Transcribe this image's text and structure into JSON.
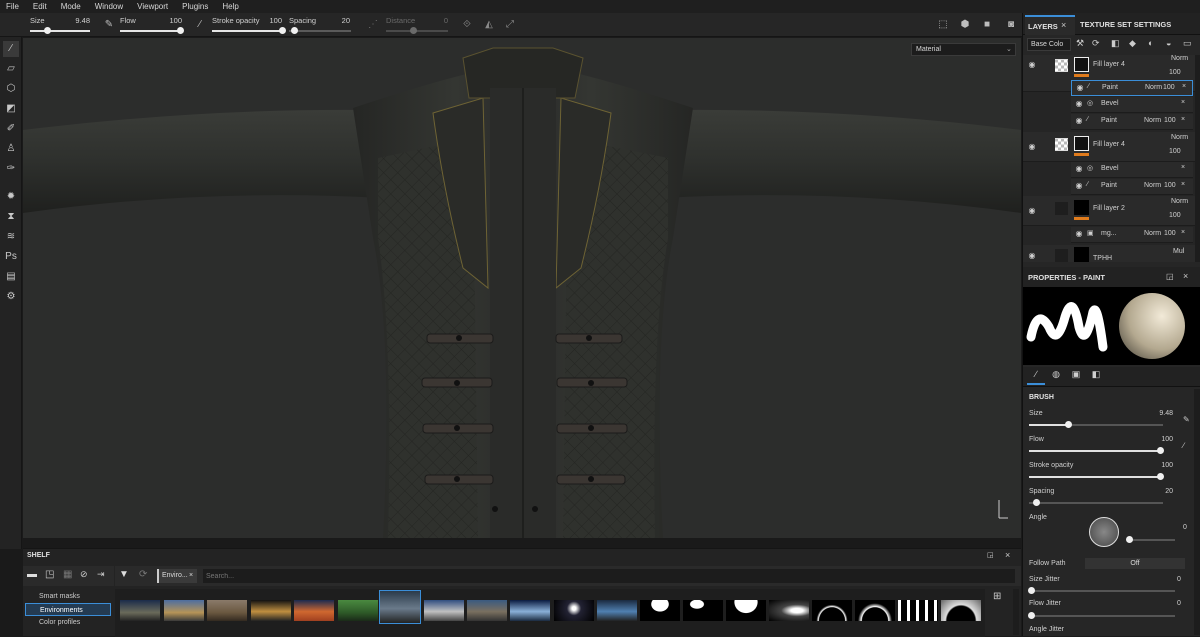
{
  "menu": [
    "File",
    "Edit",
    "Mode",
    "Window",
    "Viewport",
    "Plugins",
    "Help"
  ],
  "toolbar": {
    "size_label": "Size",
    "size_value": "9.48",
    "flow_label": "Flow",
    "flow_value": "100",
    "stroke_label": "Stroke opacity",
    "stroke_value": "100",
    "spacing_label": "Spacing",
    "spacing_value": "20",
    "distance_label": "Distance",
    "distance_value": "0"
  },
  "viewport": {
    "material_select": "Material"
  },
  "tabs": {
    "layers": "LAYERS",
    "texture_set": "TEXTURE SET SETTINGS"
  },
  "layers": {
    "channel_select": "Base Colo",
    "rows": [
      {
        "name": "Fill layer 4",
        "blend": "Norm",
        "opacity": "100"
      },
      {
        "name": "Paint",
        "blend": "Norm",
        "opacity": "100"
      },
      {
        "name": "Bevel",
        "blend": "",
        "opacity": ""
      },
      {
        "name": "Paint",
        "blend": "Norm",
        "opacity": "100"
      },
      {
        "name": "Fill layer 4",
        "blend": "Norm",
        "opacity": "100"
      },
      {
        "name": "Bevel",
        "blend": "",
        "opacity": ""
      },
      {
        "name": "Paint",
        "blend": "Norm",
        "opacity": "100"
      },
      {
        "name": "Fill layer 2",
        "blend": "Norm",
        "opacity": "100"
      },
      {
        "name": "mg...",
        "blend": "Norm",
        "opacity": "100"
      },
      {
        "name": "TPHH",
        "blend": "Mul",
        "opacity": ""
      }
    ]
  },
  "properties": {
    "title": "PROPERTIES - PAINT",
    "section": "BRUSH",
    "size_label": "Size",
    "size_value": "9.48",
    "flow_label": "Flow",
    "flow_value": "100",
    "stroke_label": "Stroke opacity",
    "stroke_value": "100",
    "spacing_label": "Spacing",
    "spacing_value": "20",
    "angle_label": "Angle",
    "angle_value": "0",
    "follow_path_label": "Follow Path",
    "follow_path_value": "Off",
    "size_jitter_label": "Size Jitter",
    "size_jitter_value": "0",
    "flow_jitter_label": "Flow Jitter",
    "flow_jitter_value": "0",
    "angle_jitter_label": "Angle Jitter"
  },
  "shelf": {
    "title": "SHELF",
    "categories": [
      "Smart masks",
      "Environments",
      "Color profiles"
    ],
    "filter_tag": "Enviro...",
    "search_placeholder": "Search..."
  },
  "colors": {
    "accent": "#3b8ed8",
    "orange": "#e07b1c"
  }
}
